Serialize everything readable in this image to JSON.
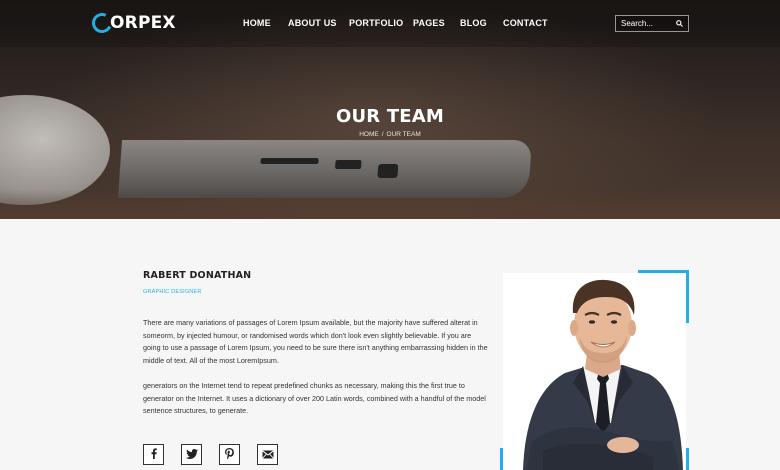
{
  "brand": {
    "logo_text": "ORPEX",
    "accent": "#1fb0ea"
  },
  "nav": {
    "items": [
      {
        "label": "HOME"
      },
      {
        "label": "ABOUT US"
      },
      {
        "label": "PORTFOLIO"
      },
      {
        "label": "PAGES"
      },
      {
        "label": "BLOG"
      },
      {
        "label": "CONTACT"
      }
    ],
    "search_placeholder": "Search..."
  },
  "hero": {
    "title": "OUR TEAM",
    "breadcrumb": {
      "home": "HOME",
      "separator": "/",
      "current": "OUR TEAM"
    }
  },
  "member": {
    "name": "RABERT DONATHAN",
    "role": "GRAPHIC DESIGNER",
    "bio_1": "There are many variations of passages of Lorem Ipsum available, but the majority have suffered alterat in someorm, by injected humour, or randomised words which don't look even slightly believable. If you are going to use a passage of Lorem Ipsum, you need to be sure there isn't anything embarrassing hidden in the middle of text. All of the most LoremIpsum.",
    "bio_2": "generators on the Internet tend to repeat predefined chunks as necessary, making this the first true to generator on the Internet. It uses a dictionary of over 200 Latin words, combined with a handful of the model sentence structures, to generate."
  },
  "socials": [
    {
      "icon": "facebook-icon"
    },
    {
      "icon": "twitter-icon"
    },
    {
      "icon": "pinterest-icon"
    },
    {
      "icon": "email-icon"
    }
  ]
}
